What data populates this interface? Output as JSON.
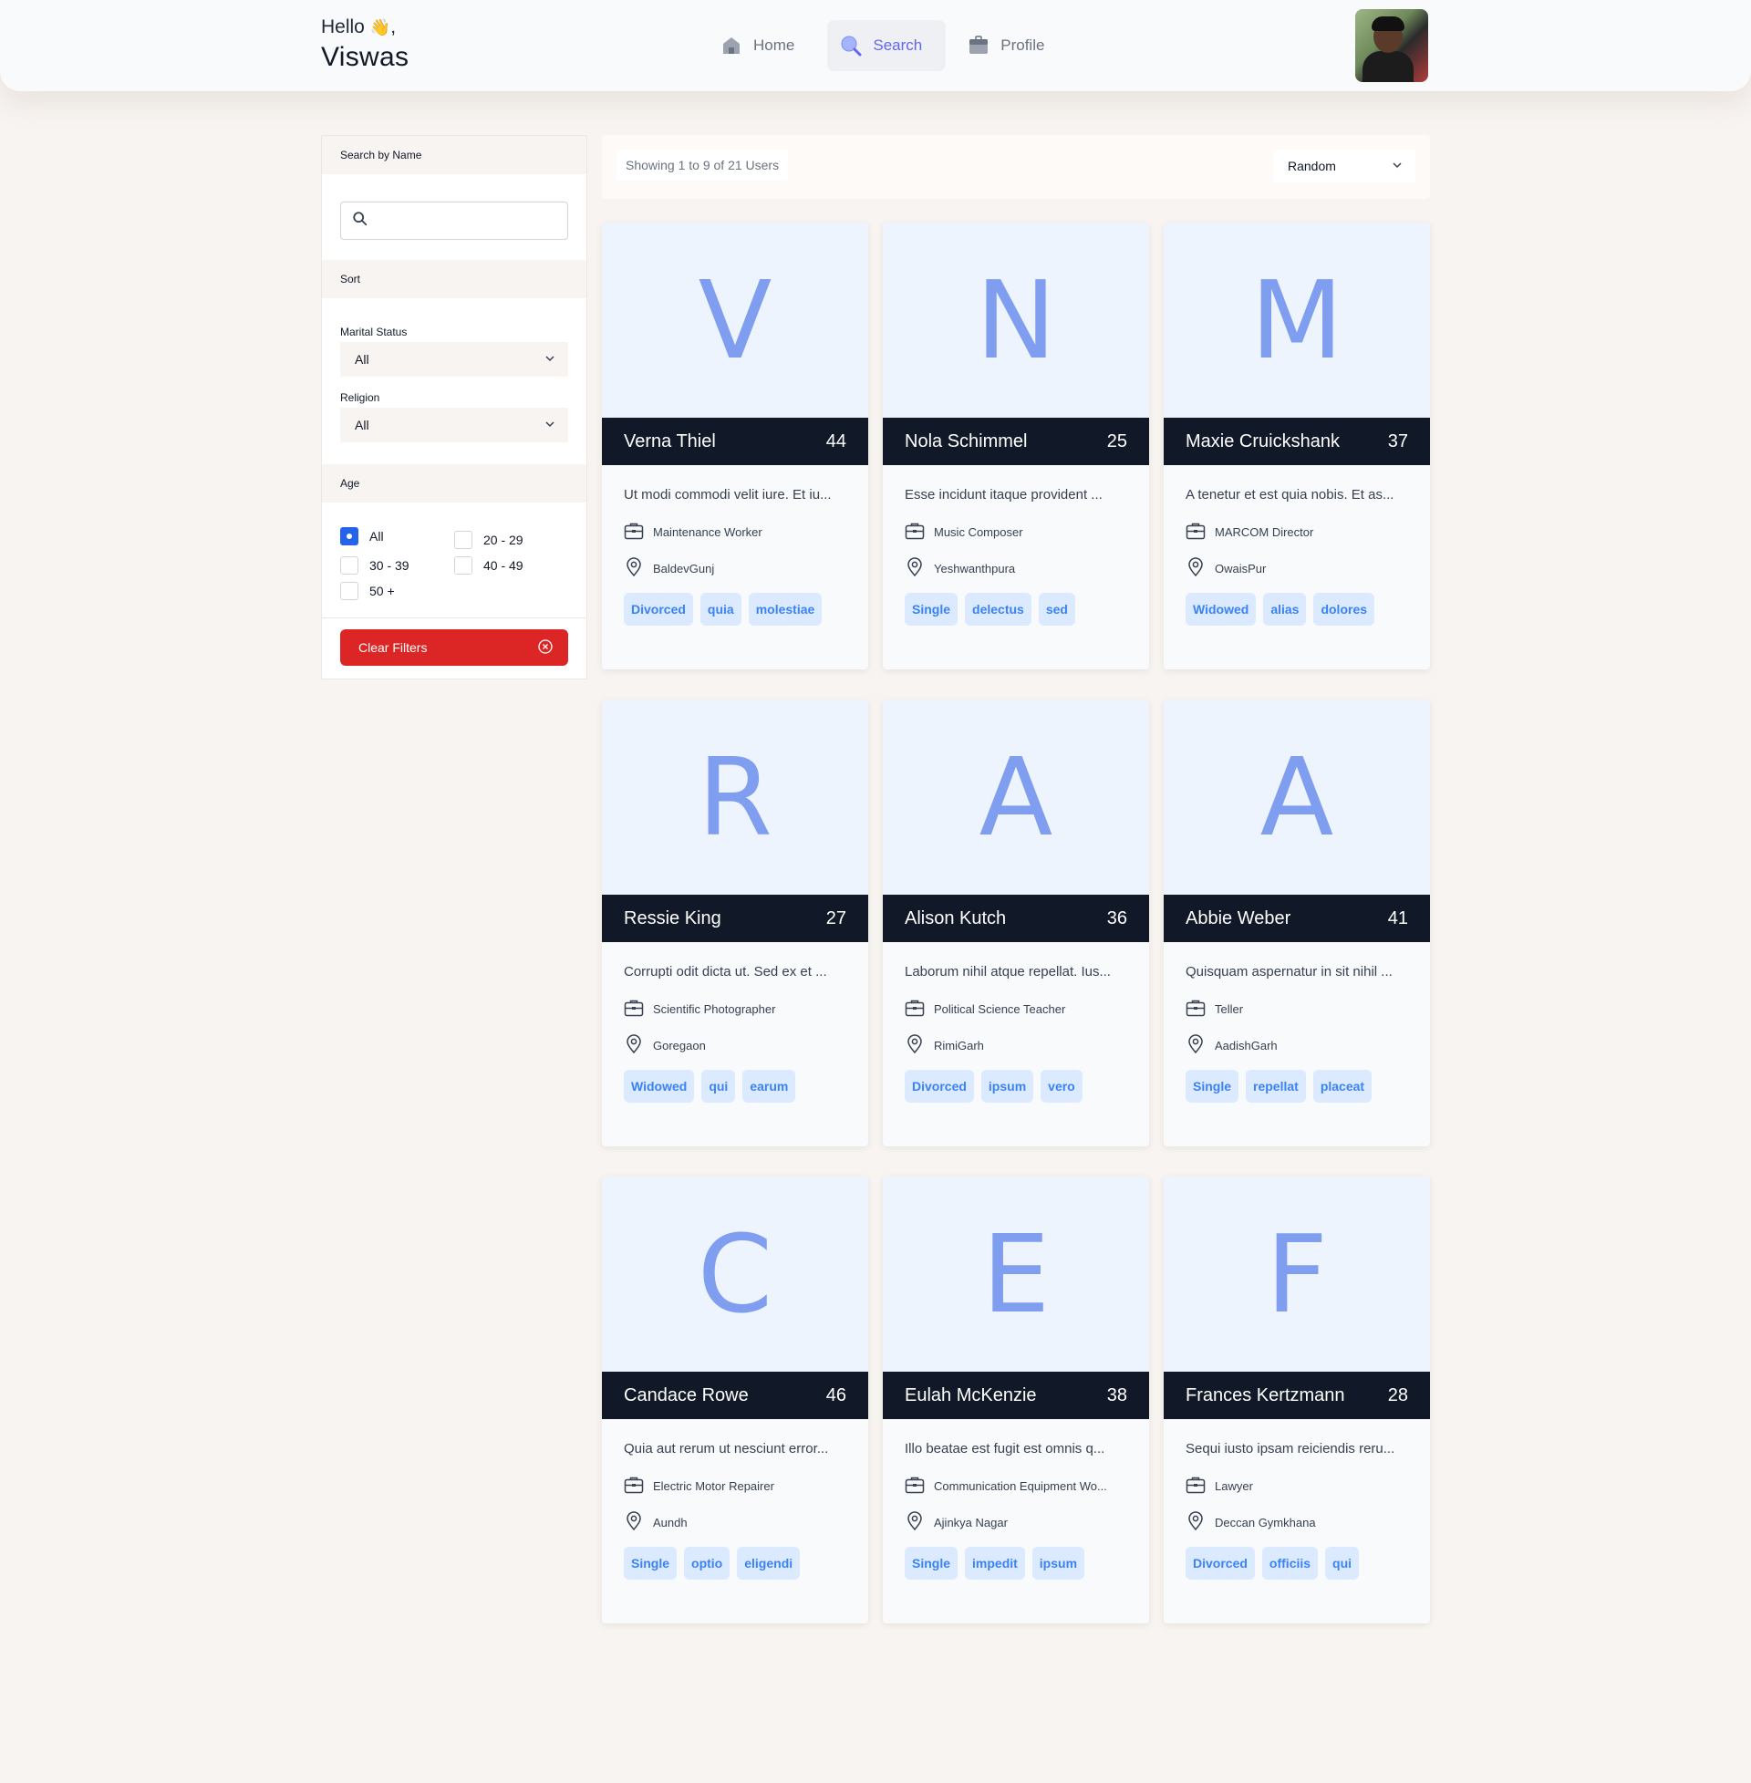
{
  "header": {
    "greeting": "Hello",
    "greeting_suffix": ",",
    "user_name": "Viswas",
    "nav": [
      {
        "label": "Home",
        "icon": "home-icon"
      },
      {
        "label": "Search",
        "icon": "search-icon"
      },
      {
        "label": "Profile",
        "icon": "briefcase-icon"
      }
    ]
  },
  "sidebar": {
    "search_heading": "Search by Name",
    "search_placeholder": "",
    "sort_heading": "Sort",
    "marital_label": "Marital Status",
    "marital_value": "All",
    "religion_label": "Religion",
    "religion_value": "All",
    "age_heading": "Age",
    "age_options": [
      {
        "label": "All",
        "checked": true
      },
      {
        "label": "20 - 29",
        "checked": false
      },
      {
        "label": "30 - 39",
        "checked": false
      },
      {
        "label": "40 - 49",
        "checked": false
      },
      {
        "label": "50 +",
        "checked": false
      }
    ],
    "clear_label": "Clear Filters"
  },
  "results": {
    "showing_text": "Showing 1 to 9 of 21 Users",
    "sort_value": "Random"
  },
  "users": [
    {
      "initial": "V",
      "name": "Verna Thiel",
      "age": "44",
      "description": "Ut modi commodi velit iure. Et iu...",
      "occupation": "Maintenance Worker",
      "location": "BaldevGunj",
      "tags": [
        "Divorced",
        "quia",
        "molestiae"
      ]
    },
    {
      "initial": "N",
      "name": "Nola Schimmel",
      "age": "25",
      "description": "Esse incidunt itaque provident ...",
      "occupation": "Music Composer",
      "location": "Yeshwanthpura",
      "tags": [
        "Single",
        "delectus",
        "sed"
      ]
    },
    {
      "initial": "M",
      "name": "Maxie Cruickshank",
      "age": "37",
      "description": "A tenetur et est quia nobis. Et as...",
      "occupation": "MARCOM Director",
      "location": "OwaisPur",
      "tags": [
        "Widowed",
        "alias",
        "dolores"
      ]
    },
    {
      "initial": "R",
      "name": "Ressie King",
      "age": "27",
      "description": "Corrupti odit dicta ut. Sed ex et ...",
      "occupation": "Scientific Photographer",
      "location": "Goregaon",
      "tags": [
        "Widowed",
        "qui",
        "earum"
      ]
    },
    {
      "initial": "A",
      "name": "Alison Kutch",
      "age": "36",
      "description": "Laborum nihil atque repellat. Ius...",
      "occupation": "Political Science Teacher",
      "location": "RimiGarh",
      "tags": [
        "Divorced",
        "ipsum",
        "vero"
      ]
    },
    {
      "initial": "A",
      "name": "Abbie Weber",
      "age": "41",
      "description": "Quisquam aspernatur in sit nihil ...",
      "occupation": "Teller",
      "location": "AadishGarh",
      "tags": [
        "Single",
        "repellat",
        "placeat"
      ]
    },
    {
      "initial": "C",
      "name": "Candace Rowe",
      "age": "46",
      "description": "Quia aut rerum ut nesciunt error...",
      "occupation": "Electric Motor Repairer",
      "location": "Aundh",
      "tags": [
        "Single",
        "optio",
        "eligendi"
      ]
    },
    {
      "initial": "E",
      "name": "Eulah McKenzie",
      "age": "38",
      "description": "Illo beatae est fugit est omnis q...",
      "occupation": "Communication Equipment Wo...",
      "location": "Ajinkya Nagar",
      "tags": [
        "Single",
        "impedit",
        "ipsum"
      ]
    },
    {
      "initial": "F",
      "name": "Frances Kertzmann",
      "age": "28",
      "description": "Sequi iusto ipsam reiciendis reru...",
      "occupation": "Lawyer",
      "location": "Deccan Gymkhana",
      "tags": [
        "Divorced",
        "officiis",
        "qui"
      ]
    }
  ]
}
